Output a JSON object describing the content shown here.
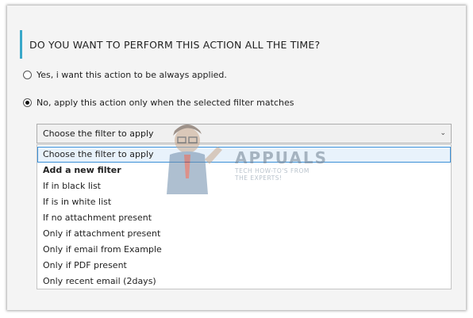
{
  "heading": "DO YOU WANT TO PERFORM THIS ACTION ALL THE TIME?",
  "options": {
    "always": {
      "label": "Yes, i want this action to be always applied.",
      "checked": false
    },
    "filter": {
      "label": "No, apply this action only when the selected filter matches",
      "checked": true
    }
  },
  "filter_select": {
    "value": "Choose the filter to apply",
    "items": [
      "Choose the filter to apply",
      "Add a new filter",
      "If in black list",
      "If is in white list",
      "If no attachment present",
      "Only if attachment present",
      "Only if email from Example",
      "Only if PDF present",
      "Only recent email (2days)"
    ]
  },
  "watermark": {
    "brand": "APPUALS",
    "tagline_1": "TECH HOW-TO'S FROM",
    "tagline_2": "THE EXPERTS!"
  },
  "colors": {
    "accent": "#3aa8c9",
    "selection_border": "#3a8fd6",
    "selection_fill": "#e8f2fb"
  },
  "icons": {
    "dropdown": "chevron-down-icon"
  }
}
